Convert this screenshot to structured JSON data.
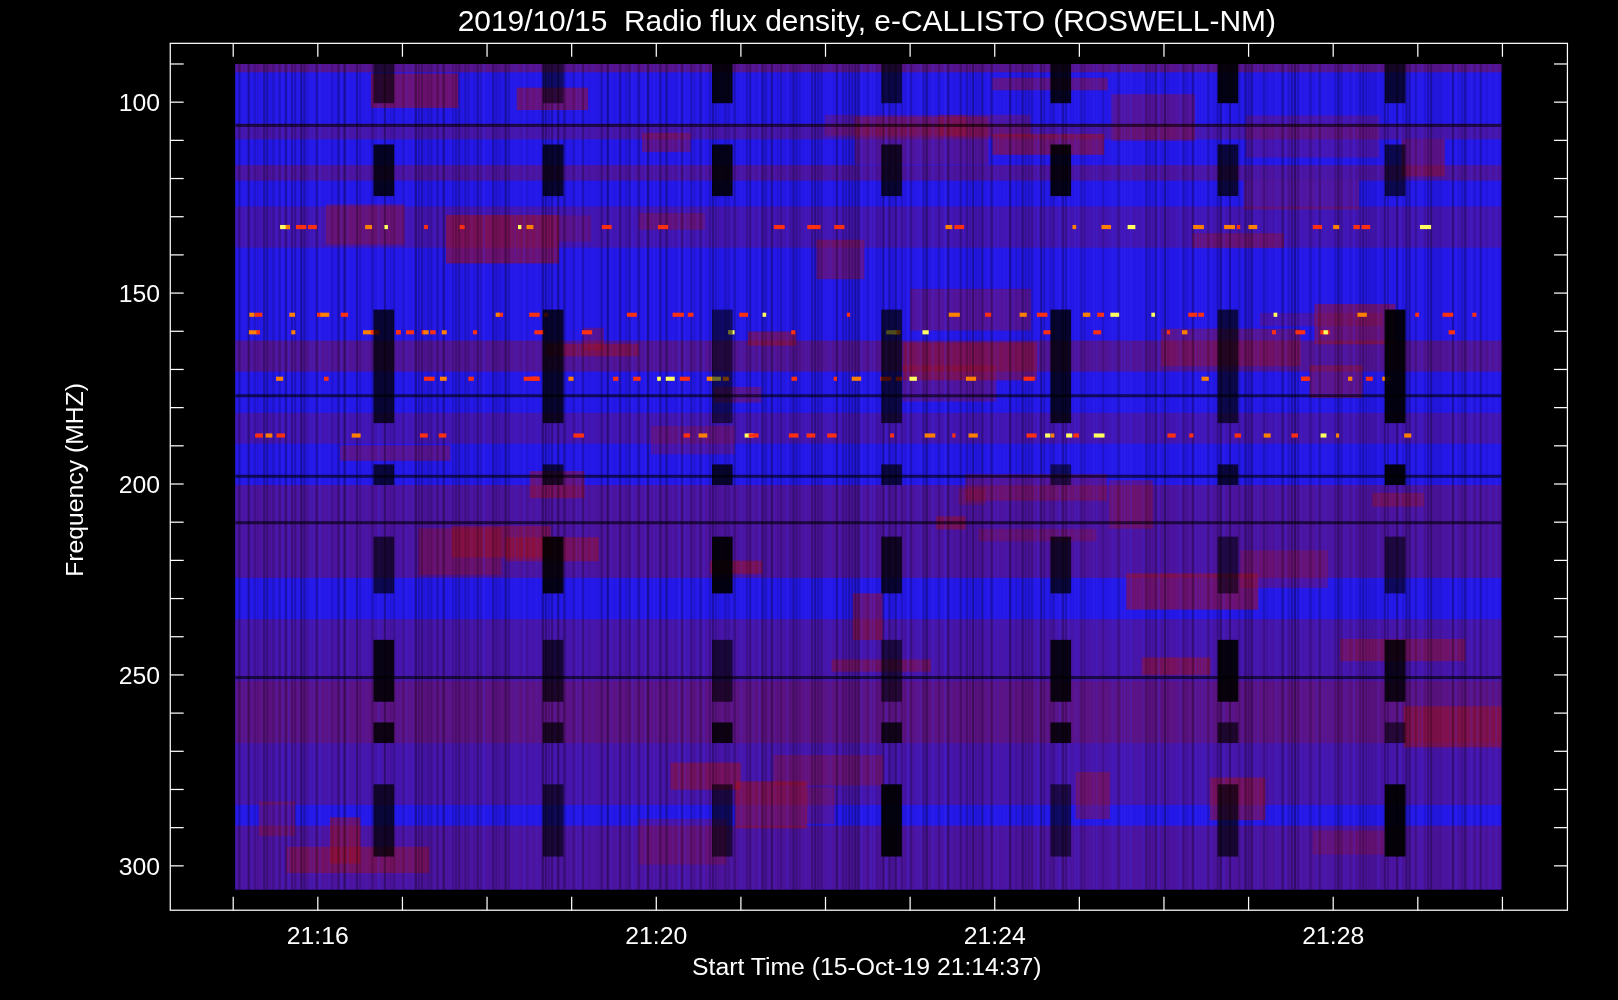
{
  "title": "2019/10/15  Radio flux density, e-CALLISTO (ROSWELL-NM)",
  "y_axis": {
    "label": "Frequency (MHZ)",
    "ticks": [
      "100",
      "150",
      "200",
      "250",
      "300"
    ]
  },
  "x_axis": {
    "label": "Start Time (15-Oct-19 21:14:37)",
    "ticks": [
      "21:16",
      "21:20",
      "21:24",
      "21:28"
    ]
  }
}
